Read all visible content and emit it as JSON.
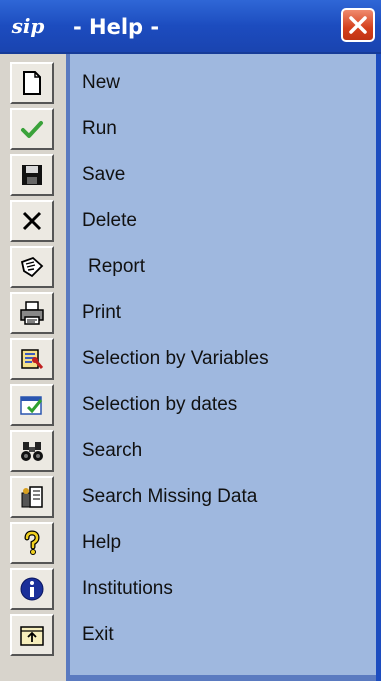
{
  "window": {
    "title": "- Help -",
    "logo_text": "sip"
  },
  "colors": {
    "titlebar": "#1c4cbf",
    "panel": "#9fb8df",
    "close_button": "#d4401c"
  },
  "menu": {
    "items": [
      {
        "label": "New",
        "icon": "new-document-icon"
      },
      {
        "label": "Run",
        "icon": "checkmark-icon"
      },
      {
        "label": "Save",
        "icon": "floppy-disk-icon"
      },
      {
        "label": "Delete",
        "icon": "delete-x-icon"
      },
      {
        "label": "Report",
        "icon": "report-icon"
      },
      {
        "label": "Print",
        "icon": "printer-icon"
      },
      {
        "label": "Selection by Variables",
        "icon": "selection-variables-icon"
      },
      {
        "label": "Selection by dates",
        "icon": "selection-dates-icon"
      },
      {
        "label": "Search",
        "icon": "binoculars-icon"
      },
      {
        "label": "Search Missing Data",
        "icon": "search-missing-icon"
      },
      {
        "label": "Help",
        "icon": "question-mark-icon"
      },
      {
        "label": "Institutions",
        "icon": "info-icon"
      },
      {
        "label": "Exit",
        "icon": "exit-folder-icon"
      }
    ]
  }
}
